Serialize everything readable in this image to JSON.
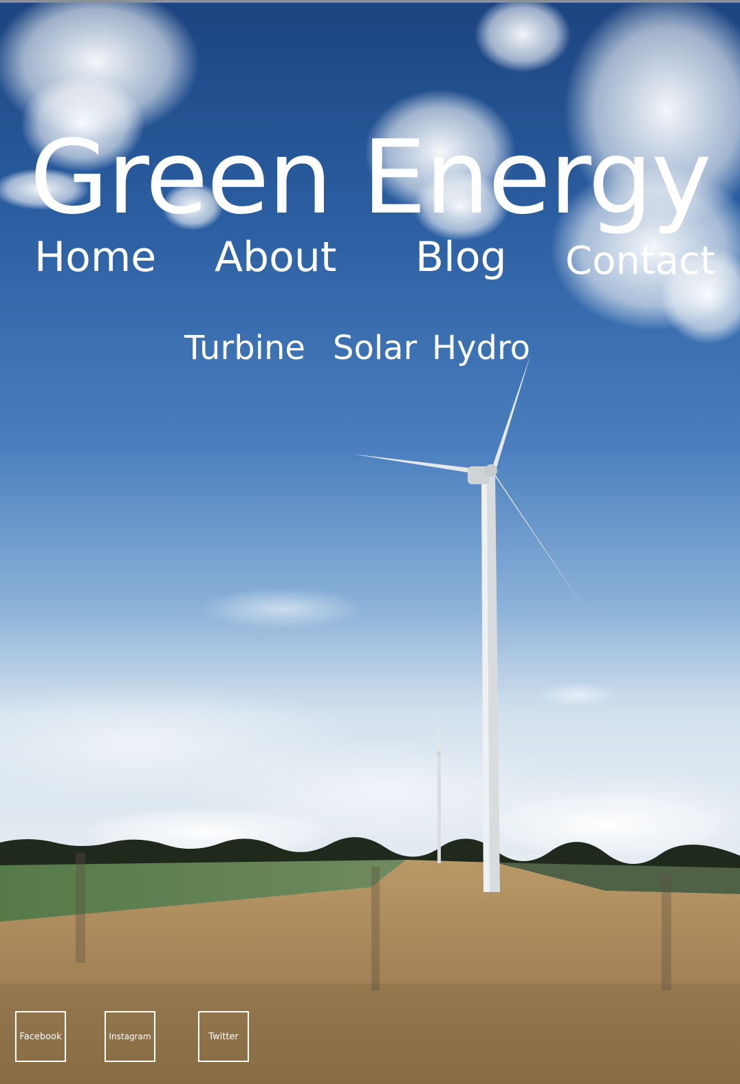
{
  "site": {
    "title": "Green Energy"
  },
  "nav": {
    "home": "Home",
    "about": "About",
    "blog": "Blog",
    "contact": "Contact"
  },
  "subnav": {
    "turbine": "Turbine",
    "solar": "Solar",
    "hydro": "Hydro"
  },
  "social": {
    "facebook": "Facebook",
    "instagram": "Instagram",
    "twitter": "Twitter"
  },
  "colors": {
    "sky_top": "#1f4a85",
    "sky_horizon": "#dfe8f0",
    "field_wheat": "#b99a62",
    "field_green": "#5d7d4a",
    "text": "#ffffff"
  }
}
